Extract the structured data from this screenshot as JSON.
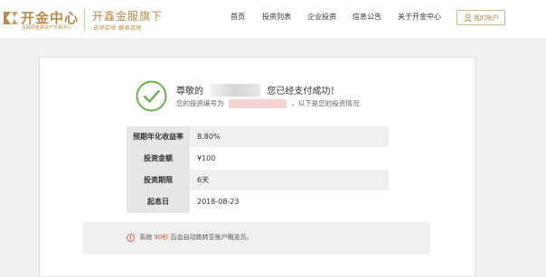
{
  "header": {
    "logo_title": "开金中心",
    "logo_subtitle": "互联网金融资产交易中心",
    "brand_title": "开鑫金服旗下",
    "brand_slogan": "支持实体  服务百姓",
    "nav": [
      "首页",
      "投资列表",
      "企业投资",
      "信息公告",
      "关于开金中心"
    ],
    "account_label": "我的账户",
    "accent_color": "#b88a4a"
  },
  "result": {
    "headline_prefix": "尊敬的",
    "headline_suffix": "您已经支付成功！",
    "sub_prefix": "您的投资编号为",
    "sub_suffix": "，以下是您的投资情况",
    "success_color": "#6ab04c"
  },
  "details": [
    {
      "label": "预期年化收益率",
      "value": "8.80%"
    },
    {
      "label": "投资金额",
      "value": "¥100"
    },
    {
      "label": "投资期限",
      "value": "6天"
    },
    {
      "label": "起息日",
      "value": "2018-08-23"
    }
  ],
  "notice": {
    "prefix": "系统",
    "seconds": "30秒",
    "suffix": "后会自动跳转至账户概览页。",
    "icon": "info-icon",
    "highlight_color": "#e0533a"
  }
}
